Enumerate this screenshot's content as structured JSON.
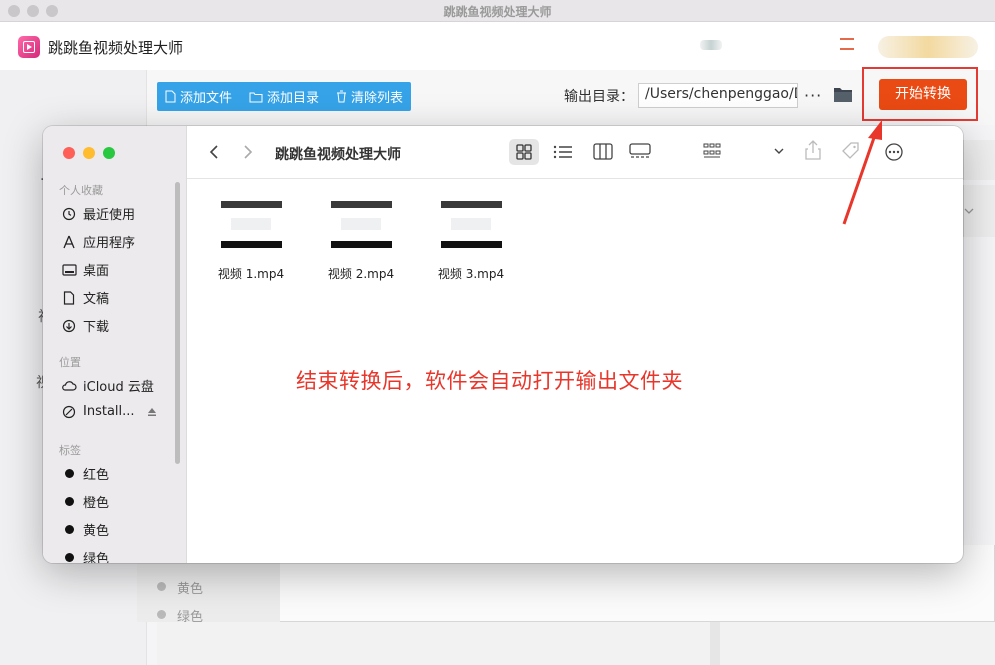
{
  "window": {
    "title": "跳跳鱼视频处理大师"
  },
  "app": {
    "name": "跳跳鱼视频处理大师"
  },
  "toolbar": {
    "add_file": "添加文件",
    "add_dir": "添加目录",
    "clear_list": "清除列表",
    "output_label": "输出目录：",
    "output_path": "/Users/chenpenggao/D",
    "more": "···",
    "start": "开始转换"
  },
  "finder": {
    "title": "跳跳鱼视频处理大师",
    "sidebar": {
      "favorites_header": "个人收藏",
      "favorites": [
        "最近使用",
        "应用程序",
        "桌面",
        "文稿",
        "下载"
      ],
      "locations_header": "位置",
      "locations": [
        "iCloud 云盘",
        "Install..."
      ],
      "tags_header": "标签",
      "tags": [
        "红色",
        "橙色",
        "黄色",
        "绿色"
      ]
    },
    "files": [
      "视频 1.mp4",
      "视频 2.mp4",
      "视频 3.mp4"
    ]
  },
  "background_panel": {
    "tags": [
      "黄色",
      "绿色"
    ]
  },
  "annotation": "结束转换后，软件会自动打开输出文件夹",
  "colors": {
    "accent_blue": "#36a3e8",
    "start_button": "#ea4a13",
    "annotation_red": "#e8362b"
  }
}
